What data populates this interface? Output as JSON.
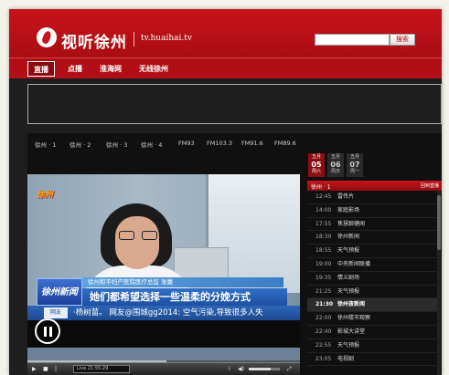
{
  "header": {
    "logo_text": "视听徐州",
    "url_text": "tv.huaihai.tv",
    "search_placeholder": "",
    "search_button": "搜索"
  },
  "nav": {
    "items": [
      {
        "label": "直播",
        "active": true
      },
      {
        "label": "点播",
        "active": false
      },
      {
        "label": "淮海网",
        "active": false
      },
      {
        "label": "无线徐州",
        "active": false
      }
    ]
  },
  "channels": [
    "徐州 · 1",
    "徐州 · 2",
    "徐州 · 3",
    "徐州 · 4",
    "FM93",
    "FM103.3",
    "FM91.6",
    "FM89.6"
  ],
  "video": {
    "station_bug": "徐州",
    "show_logo": "徐州新闻",
    "speaker_tag": "徐州和平妇产医院医疗总监  张蕾",
    "caption": "她们都希望选择一些温柔的分娩方式",
    "ticker_label": "网友",
    "ticker_text": "·杨树苗。      网友@围城gg2014: 空气污染,导致很多人失"
  },
  "controls": {
    "live_label": "Live",
    "live_time": "21:55:29",
    "progress_fraction": 0.51,
    "volume_fraction": 0.7
  },
  "schedule": {
    "dates": [
      {
        "month": "五月",
        "day": "05",
        "weekday": "周六",
        "active": true
      },
      {
        "month": "五月",
        "day": "06",
        "weekday": "周日",
        "active": false
      },
      {
        "month": "五月",
        "day": "07",
        "weekday": "周一",
        "active": false
      }
    ],
    "channel_name": "徐州 · 1",
    "back_link": "回到直播",
    "items": [
      {
        "time": "12:45",
        "name": "雷传片",
        "current": false
      },
      {
        "time": "14:00",
        "name": "家庭影场",
        "current": false
      },
      {
        "time": "17:55",
        "name": "焦慧聊健闻",
        "current": false
      },
      {
        "time": "18:30",
        "name": "徐州新闻",
        "current": false
      },
      {
        "time": "18:55",
        "name": "天气预报",
        "current": false
      },
      {
        "time": "19:00",
        "name": "中央新闻联播",
        "current": false
      },
      {
        "time": "19:35",
        "name": "情义剧场",
        "current": false
      },
      {
        "time": "21:25",
        "name": "天气预报",
        "current": false
      },
      {
        "time": "21:30",
        "name": "徐州夜新闻",
        "current": true
      },
      {
        "time": "22:00",
        "name": "徐州楼市观察",
        "current": false
      },
      {
        "time": "22:40",
        "name": "影城大讲堂",
        "current": false
      },
      {
        "time": "22:55",
        "name": "天气预报",
        "current": false
      },
      {
        "time": "23:05",
        "name": "电视剧",
        "current": false
      }
    ]
  },
  "colors": {
    "brand_red": "#c9131a",
    "caption_blue": "#2f6fc9",
    "background": "#1e1e1e"
  }
}
